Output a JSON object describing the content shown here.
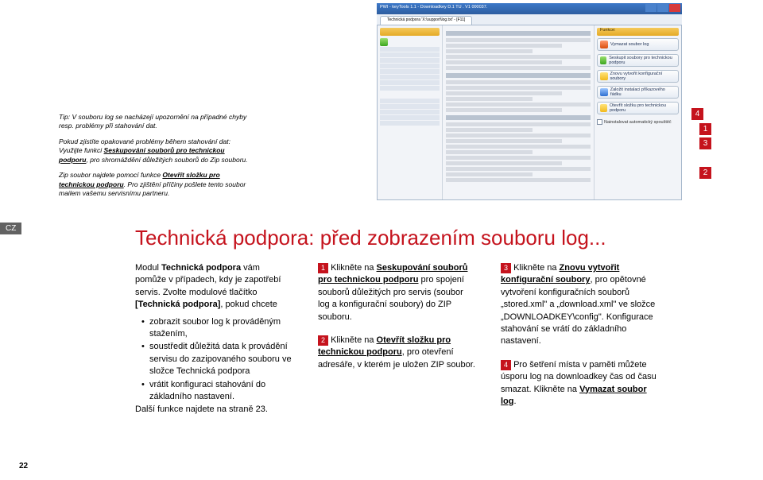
{
  "lang_tab": "CZ",
  "title": "Technická podpora: před zobrazením souboru log...",
  "page_number": "22",
  "tip": {
    "p1_before": "Tip: V souboru log se nacházejí upozornění na případné chyby resp. problémy při stahování dat.",
    "p2_a": "Pokud zjistíte opakované problémy během stahování dat: Využijte funkci ",
    "p2_link1": "Seskupování souborů pro technickou podporu",
    "p2_b": ", pro shromáždění důležitých souborů do Zip souboru.",
    "p3_a": "Zip soubor najdete pomocí funkce ",
    "p3_link": "Otevřít složku pro technickou podporu",
    "p3_b": ". Pro zjištění příčiny pošlete tento soubor mailem vašemu servisnímu partneru."
  },
  "col1": {
    "intro_a": "Modul ",
    "intro_b": "Technická podpora",
    "intro_c": " vám pomůže v případech, kdy je zapotřebí servis. Zvolte modulové tlačítko ",
    "intro_d": "[Technická podpora]",
    "intro_e": ", pokud chcete",
    "li1": "zobrazit soubor log k prováděným stažením,",
    "li2": "soustředit důležitá data k provádění servisu do zazipovaného souboru ve složce Technická podpora",
    "li3": "vrátit konfiguraci stahování do základního nastavení.",
    "outro": "Další funkce najdete na straně 23."
  },
  "steps": {
    "s1_a": "Klikněte na ",
    "s1_link": "Seskupování souborů pro technickou podporu",
    "s1_b": " pro spojení souborů důležitých pro servis (soubor log a konfigurační soubory) do ZIP souboru.",
    "s2_a": "Klikněte na ",
    "s2_link": "Otevřít složku pro technickou podporu",
    "s2_b": ", pro otevření adresáře, v kterém je uložen ZIP soubor.",
    "s3_a": "Klikněte na ",
    "s3_link": "Znovu vytvořit konfigurační soubory",
    "s3_b": ", pro opětovné vytvoření konfiguračních souborů „stored.xml\" a „download.xml\" ve složce „DOWNLOADKEY\\config\". Konfigurace stahování se vrátí do základního nastavení.",
    "s4_a": "Pro šetření místa v paměti můžete úsporu log na downloadkey čas od času smazat. Klikněte na ",
    "s4_link": "Vymazat soubor log",
    "s4_b": "."
  },
  "shot": {
    "window_title": "PWI - keyTools 1.1 - Downloadkey D.1 TU . V1 000037.",
    "tab": "Technická podpora 'X:\\support\\log.txt' - [F11]",
    "right_hdr": "Funkce:",
    "b1": "Vymazat soubor log",
    "b2": "Seskupit soubory pro technickou podporu",
    "b3": "Znovu vytvořit konfigurační soubory",
    "b4": "Založit instalaci příkazového řádku",
    "b5": "Otevřít složku pro technickou podporu",
    "chk": "Nainstalovat automatický spouštěč"
  },
  "callouts": {
    "c1": "1",
    "c2": "2",
    "c3": "3",
    "c4": "4"
  }
}
